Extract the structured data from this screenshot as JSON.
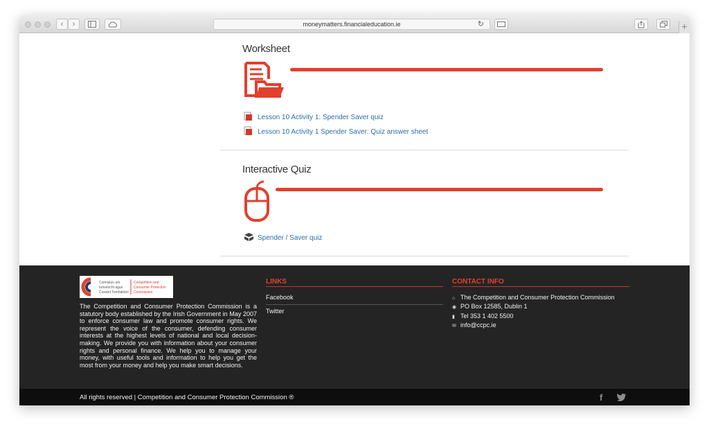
{
  "browser": {
    "url": "moneymatters.financialeducation.ie",
    "reload_glyph": "↻",
    "back_glyph": "‹",
    "forward_glyph": "›",
    "new_tab_glyph": "+"
  },
  "worksheet": {
    "title": "Worksheet",
    "icon": "document-folder-icon",
    "links": [
      {
        "label": "Lesson 10 Activity 1: Spender Saver quiz",
        "icon": "pdf-icon"
      },
      {
        "label": "Lesson 10 Activity 1 Spender Saver: Quiz answer sheet",
        "icon": "pdf-icon"
      }
    ]
  },
  "quiz": {
    "title": "Interactive Quiz",
    "icon": "mouse-icon",
    "links": [
      {
        "label": "Spender / Saver quiz",
        "icon": "box-icon"
      }
    ]
  },
  "footer": {
    "logo_text_left": "Coimisiún um\nIomaíocht agus\nCosaint Tomhaltóirí",
    "logo_text_right": "Competition and\nConsumer Protection\nCommission",
    "about": "The Competition and Consumer Protection Commission is a statutory body established by the Irish Government in May 2007 to enforce consumer law and promote consumer rights. We represent the voice of the consumer, defending consumer interests at the highest levels of national and local decision-making. We provide you with information about your consumer rights and personal finance. We help you to manage your money, with useful tools and information to help you get the most from your money and help you make smart decisions.",
    "links_heading": "LINKS",
    "links": [
      "Facebook",
      "Twitter"
    ],
    "contact_heading": "CONTACT INFO",
    "contact": [
      {
        "icon": "home-icon",
        "glyph": "⌂",
        "text": "The Competition and Consumer Protection Commission"
      },
      {
        "icon": "location-icon",
        "glyph": "◉",
        "text": "PO Box 12585, Dublin 1"
      },
      {
        "icon": "phone-icon",
        "glyph": "▮",
        "text": "Tel 353 1 402 5500"
      },
      {
        "icon": "email-icon",
        "glyph": "✉",
        "text": "info@ccpc.ie"
      }
    ],
    "rights": "All rights reserved | Competition and Consumer Protection Commission ®",
    "social": [
      {
        "icon": "facebook-icon",
        "glyph": "f"
      },
      {
        "icon": "twitter-icon",
        "glyph": "🐦"
      }
    ]
  },
  "colors": {
    "accent": "#e2402d",
    "link": "#2d6ea5",
    "footer_bg": "#242424",
    "bottom_bar_bg": "#0e0e0e"
  }
}
